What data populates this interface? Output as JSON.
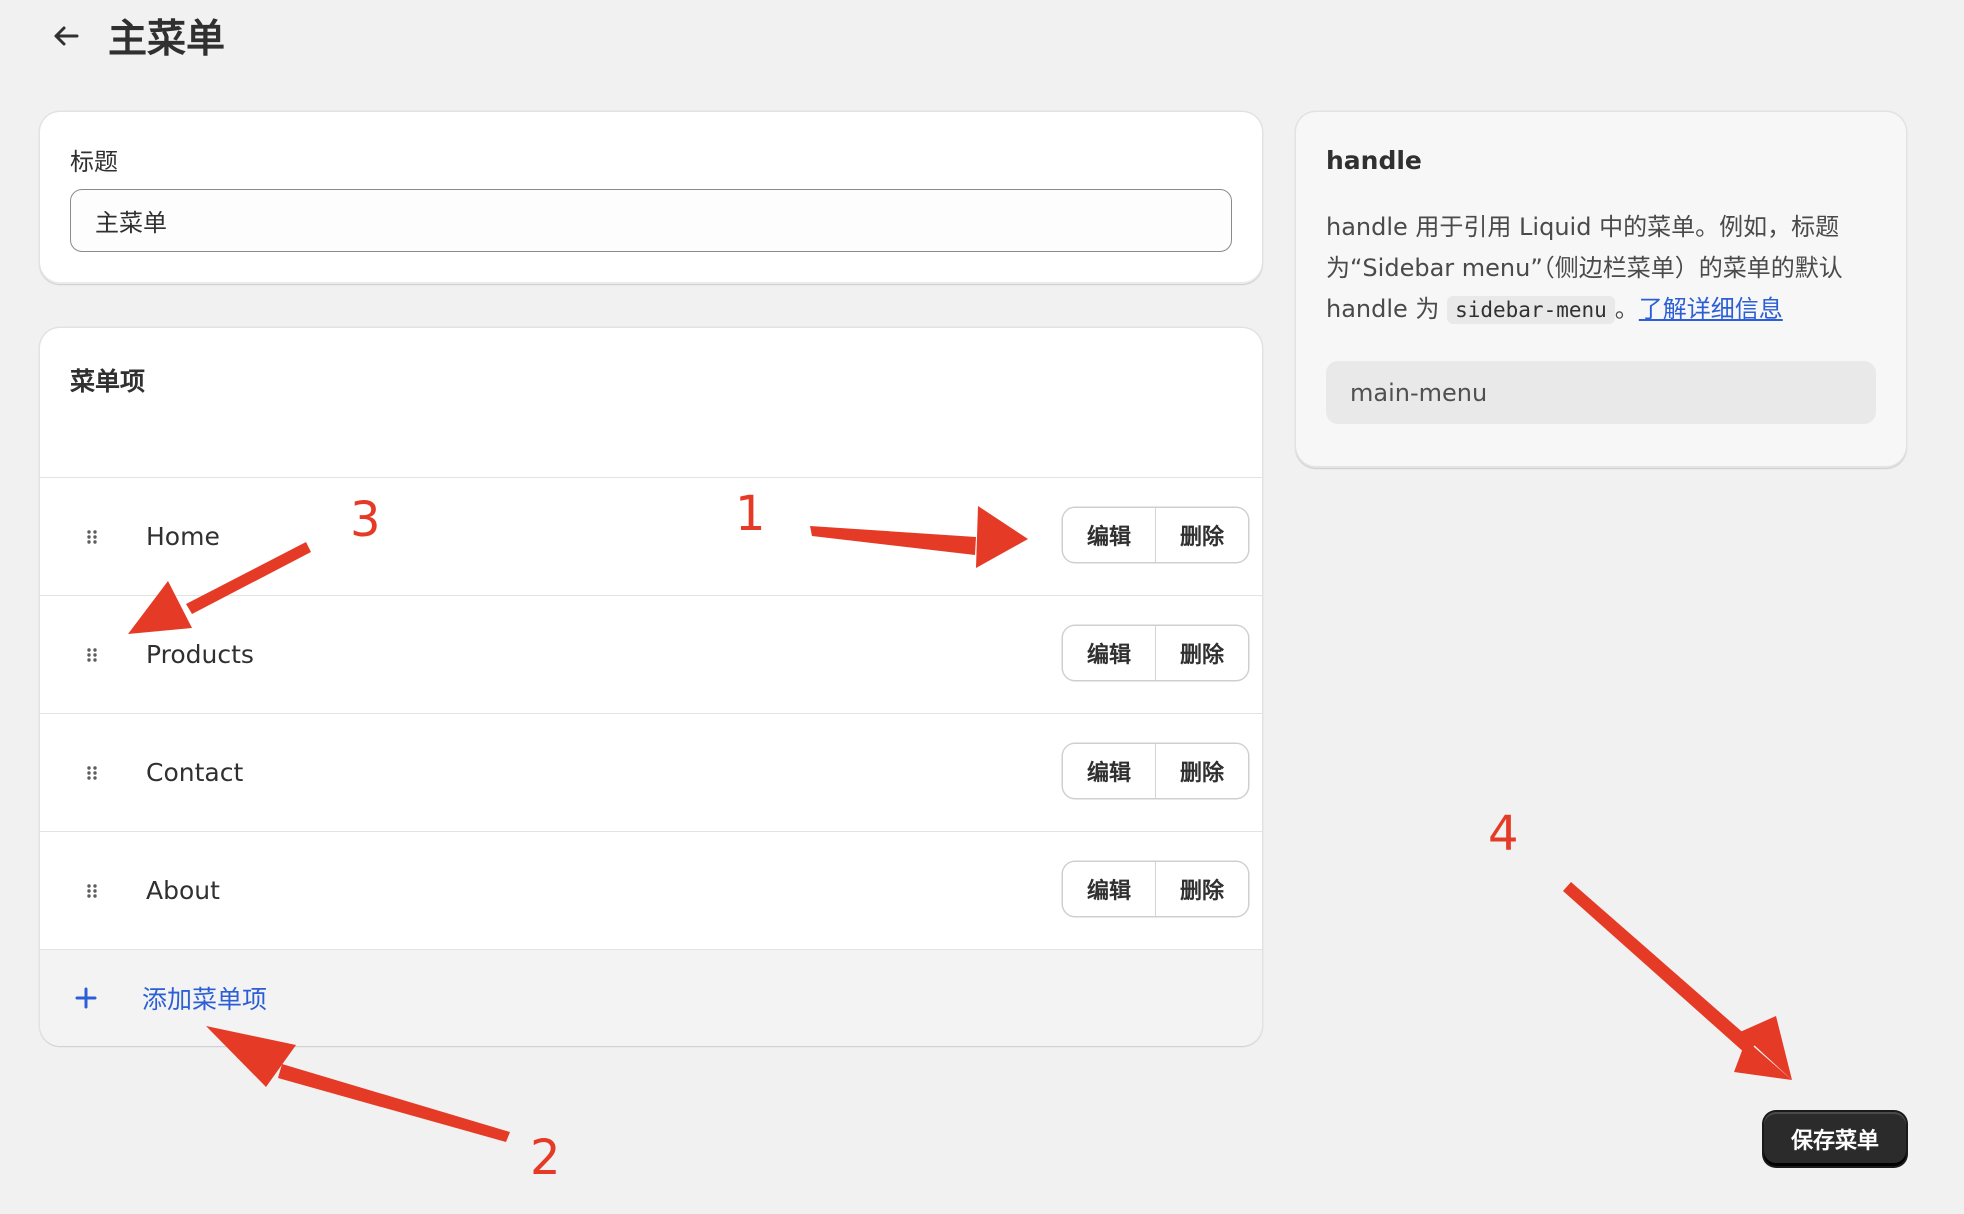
{
  "header": {
    "title": "主菜单",
    "back_icon": "arrow-left-icon"
  },
  "title_card": {
    "label": "标题",
    "value": "主菜单"
  },
  "menu_items_card": {
    "title": "菜单项",
    "items": [
      {
        "label": "Home",
        "edit_label": "编辑",
        "delete_label": "删除"
      },
      {
        "label": "Products",
        "edit_label": "编辑",
        "delete_label": "删除"
      },
      {
        "label": "Contact",
        "edit_label": "编辑",
        "delete_label": "删除"
      },
      {
        "label": "About",
        "edit_label": "编辑",
        "delete_label": "删除"
      }
    ],
    "add_label": "添加菜单项"
  },
  "handle_card": {
    "title": "handle",
    "description_part1": "handle 用于引用 Liquid 中的菜单。例如，标题为“Sidebar menu”（侧边栏菜单）的菜单的默认 handle 为 ",
    "code": "sidebar-menu",
    "description_part2": "。",
    "link_text": "了解详细信息",
    "value": "main-menu"
  },
  "save_button": {
    "label": "保存菜单"
  },
  "annotations": {
    "color": "#e53b26",
    "labels": [
      "1",
      "2",
      "3",
      "4"
    ]
  },
  "colors": {
    "background": "#f1f1f1",
    "link": "#2c5fd6",
    "primary_button": "#2b2b2b"
  }
}
